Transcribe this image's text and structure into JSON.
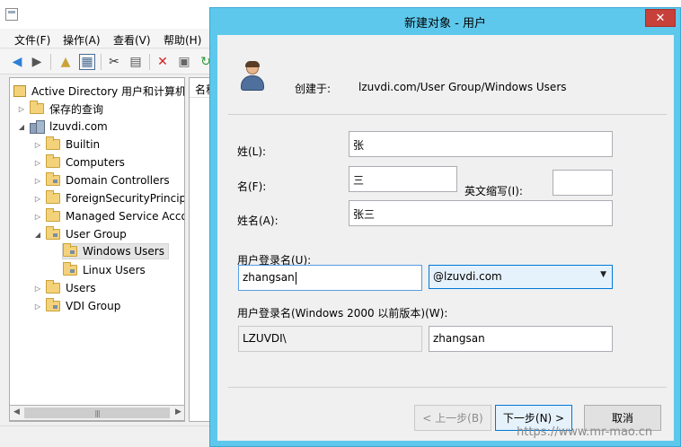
{
  "mmc": {
    "menu": [
      "文件(F)",
      "操作(A)",
      "查看(V)",
      "帮助(H)"
    ],
    "tree": {
      "root": "Active Directory 用户和计算机",
      "saved_queries": "保存的查询",
      "domain": "lzuvdi.com",
      "containers": [
        "Builtin",
        "Computers",
        "Domain Controllers",
        "ForeignSecurityPrincipa",
        "Managed Service Acco",
        "User Group"
      ],
      "user_group_children": [
        "Windows Users",
        "Linux Users"
      ],
      "after_containers": [
        "Users",
        "VDI Group"
      ]
    },
    "list_header": "名称"
  },
  "dialog": {
    "title": "新建对象 - 用户",
    "close_glyph": "✕",
    "create_in_label": "创建于:",
    "create_in_path": "lzuvdi.com/User Group/Windows Users",
    "last_name_label": "姓(L):",
    "last_name_value": "张",
    "first_name_label": "名(F):",
    "first_name_value": "三",
    "initials_label": "英文缩写(I):",
    "initials_value": "",
    "full_name_label": "姓名(A):",
    "full_name_value": "张三",
    "upn_label": "用户登录名(U):",
    "upn_value": "zhangsan",
    "upn_domain": "@lzuvdi.com",
    "pre2000_label": "用户登录名(Windows 2000 以前版本)(W):",
    "pre2000_domain": "LZUVDI\\",
    "pre2000_value": "zhangsan",
    "back_button": "< 上一步(B)",
    "next_button": "下一步(N) >",
    "cancel_button": "取消"
  },
  "watermark": "https://www.mr-mao.cn"
}
